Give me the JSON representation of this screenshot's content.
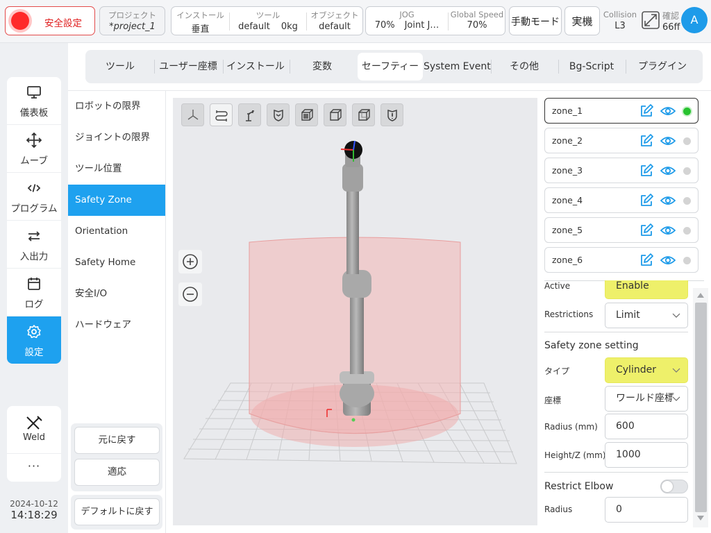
{
  "topbar": {
    "safety": {
      "label": "安全設定"
    },
    "project": {
      "caption": "プロジェクト",
      "value": "*project_1"
    },
    "install": {
      "caption": "インストール",
      "value": "垂直"
    },
    "tool": {
      "caption": "ツール",
      "name": "default",
      "weight": "0kg"
    },
    "object": {
      "caption": "オブジェクト",
      "value": "default"
    },
    "jog": {
      "caption": "JOG",
      "speed": "70%",
      "mode": "Joint J…"
    },
    "global_speed": {
      "caption": "Global Speed",
      "value": "70%"
    },
    "manual_mode": "手動モード",
    "actual": "実機",
    "collision": {
      "caption": "Collision",
      "value": "L3"
    },
    "confirm": {
      "caption": "確認",
      "value": "66ff"
    },
    "avatar": "A"
  },
  "left_nav": {
    "items": [
      {
        "label": "儀表板",
        "icon": "monitor-icon"
      },
      {
        "label": "ムーブ",
        "icon": "move-icon"
      },
      {
        "label": "プログラム",
        "icon": "code-icon"
      },
      {
        "label": "入出力",
        "icon": "io-arrows-icon"
      },
      {
        "label": "ログ",
        "icon": "calendar-icon"
      },
      {
        "label": "設定",
        "icon": "gear-icon",
        "active": true
      }
    ],
    "weld": "Weld",
    "more": "···"
  },
  "clock": {
    "date": "2024-10-12",
    "time": "14:18:29"
  },
  "tabs": [
    {
      "label": "ツール"
    },
    {
      "label": "ユーザー座標"
    },
    {
      "label": "インストール"
    },
    {
      "label": "変数"
    },
    {
      "label": "セーフティー",
      "active": true
    },
    {
      "label": "System Event"
    },
    {
      "label": "その他"
    },
    {
      "label": "Bg-Script"
    },
    {
      "label": "プラグイン"
    }
  ],
  "submenu": {
    "items": [
      {
        "label": "ロボットの限界"
      },
      {
        "label": "ジョイントの限界"
      },
      {
        "label": "ツール位置"
      },
      {
        "label": "Safety Zone",
        "active": true
      },
      {
        "label": "Orientation"
      },
      {
        "label": "Safety Home"
      },
      {
        "label": "安全I/O"
      },
      {
        "label": "ハードウェア"
      }
    ],
    "revert": "元に戻す",
    "apply": "適応",
    "default": "デフォルトに戻す"
  },
  "zones": [
    {
      "name": "zone_1",
      "active": true
    },
    {
      "name": "zone_2",
      "active": false
    },
    {
      "name": "zone_3",
      "active": false
    },
    {
      "name": "zone_4",
      "active": false
    },
    {
      "name": "zone_5",
      "active": false
    },
    {
      "name": "zone_6",
      "active": false
    }
  ],
  "form": {
    "active": {
      "label": "Active",
      "value": "Enable"
    },
    "restrictions": {
      "label": "Restrictions",
      "value": "Limit"
    },
    "section": "Safety zone setting",
    "type": {
      "label": "タイプ",
      "value": "Cylinder"
    },
    "coord": {
      "label": "座標",
      "value": "ワールド座標"
    },
    "radius": {
      "label": "Radius (mm)",
      "value": "600"
    },
    "height": {
      "label": "Height/Z (mm)",
      "value": "1000"
    },
    "elbow": {
      "label": "Restrict Elbow",
      "enabled": false
    },
    "elbow_radius": {
      "label": "Radius",
      "value": "0"
    }
  },
  "colors": {
    "accent": "#1ea1ef",
    "danger": "#e02020",
    "highlight": "#eef06a",
    "zone_fill": "#f2b5b5"
  }
}
